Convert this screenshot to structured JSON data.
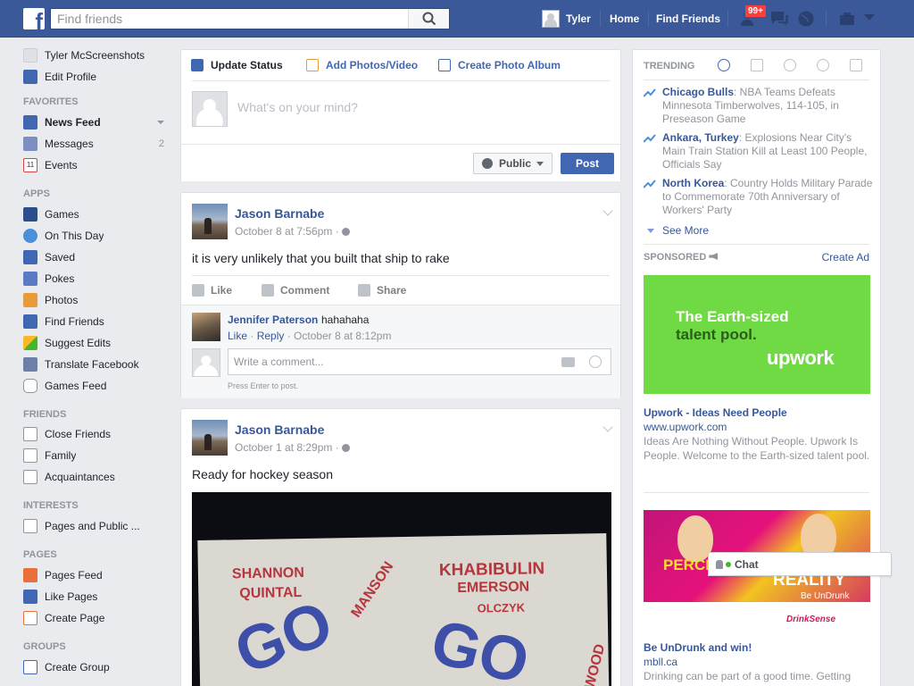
{
  "topbar": {
    "logo_letter": "f",
    "search_placeholder": "Find friends",
    "user_name": "Tyler",
    "home_label": "Home",
    "find_friends_label": "Find Friends",
    "friend_requests_badge": "99+"
  },
  "leftnav": {
    "profile_name": "Tyler McScreenshots",
    "edit_profile": "Edit Profile",
    "favorites_header": "FAVORITES",
    "news_feed": "News Feed",
    "messages": "Messages",
    "messages_count": "2",
    "events": "Events",
    "events_icon_text": "11",
    "apps_header": "APPS",
    "apps": [
      "Games",
      "On This Day",
      "Saved",
      "Pokes",
      "Photos",
      "Find Friends",
      "Suggest Edits",
      "Translate Facebook",
      "Games Feed"
    ],
    "friends_header": "FRIENDS",
    "friends": [
      "Close Friends",
      "Family",
      "Acquaintances"
    ],
    "interests_header": "INTERESTS",
    "interests": [
      "Pages and Public ..."
    ],
    "pages_header": "PAGES",
    "pages": [
      "Pages Feed",
      "Like Pages",
      "Create Page"
    ],
    "groups_header": "GROUPS",
    "groups": [
      "Create Group"
    ]
  },
  "composer": {
    "tab_update_status": "Update Status",
    "tab_add_photos": "Add Photos/Video",
    "tab_create_album": "Create Photo Album",
    "placeholder": "What's on your mind?",
    "privacy_label": "Public",
    "post_label": "Post"
  },
  "posts": [
    {
      "author": "Jason Barnabe",
      "time": "October 8 at 7:56pm ·",
      "text": "it is very unlikely that you built that ship to rake",
      "like": "Like",
      "comment": "Comment",
      "share": "Share",
      "comments": [
        {
          "author": "Jennifer Paterson",
          "text": "hahahaha",
          "like": "Like",
          "reply": "Reply",
          "time": "October 8 at 8:12pm"
        }
      ],
      "comment_placeholder": "Write a comment...",
      "hint": "Press Enter to post."
    },
    {
      "author": "Jason Barnabe",
      "time": "October 1 at 8:29pm ·",
      "text": "Ready for hockey season",
      "photo_words": [
        "SHANNON",
        "QUINTAL",
        "MANSON",
        "KHABIBULIN",
        "EMERSON",
        "OLCZYK",
        "ATWOOD"
      ]
    }
  ],
  "trending": {
    "label": "TRENDING",
    "items": [
      {
        "topic": "Chicago Bulls",
        "desc": ": NBA Teams Defeats Minnesota Timberwolves, 114-105, in Preseason Game"
      },
      {
        "topic": "Ankara, Turkey",
        "desc": ": Explosions Near City's Main Train Station Kill at Least 100 People, Officials Say"
      },
      {
        "topic": "North Korea",
        "desc": ": Country Holds Military Parade to Commemorate 70th Anniversary of Workers' Party"
      }
    ],
    "see_more": "See More"
  },
  "sponsored": {
    "label": "SPONSORED",
    "create_ad": "Create Ad",
    "ads": [
      {
        "image_line1": "The Earth-sized",
        "image_line2": "talent pool.",
        "image_logo": "upwork",
        "title": "Upwork - Ideas Need People",
        "url": "www.upwork.com",
        "desc": "Ideas Are Nothing Without People. Upwork Is People. Welcome to the Earth-sized talent pool."
      },
      {
        "image_word1": "PERCE",
        "image_word2": "REALITY",
        "image_sub": "Be UnDrunk",
        "image_brand": "DrinkSense",
        "title": "Be UnDrunk and win!",
        "url": "mbll.ca",
        "desc": "Drinking can be part of a good time. Getting"
      }
    ]
  },
  "chat": {
    "label": "Chat"
  }
}
